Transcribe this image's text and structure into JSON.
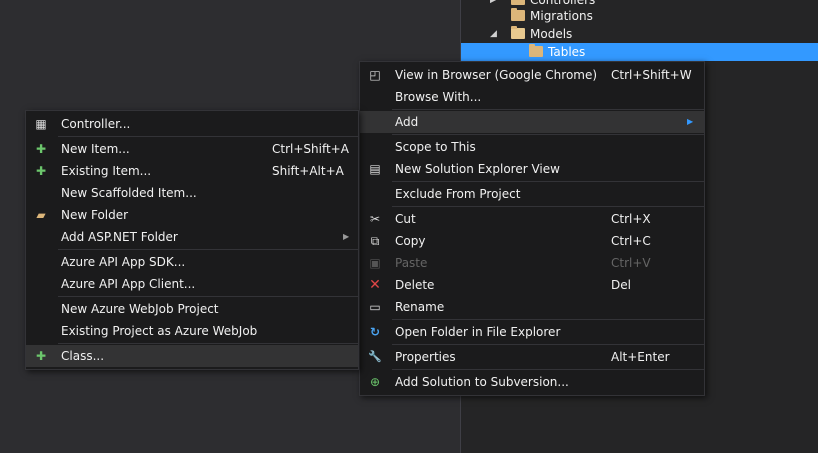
{
  "solution_explorer": {
    "items": [
      {
        "label": "Controllers",
        "arrow": "▶",
        "icon": "folder-icon"
      },
      {
        "label": "Migrations",
        "arrow": "",
        "icon": "folder-icon"
      },
      {
        "label": "Models",
        "arrow": "◢",
        "icon": "folder-open-icon"
      },
      {
        "label": "Tables",
        "arrow": "",
        "icon": "folder-icon",
        "selected": true
      }
    ]
  },
  "context_menu": {
    "items": [
      {
        "label": "View in Browser (Google Chrome)",
        "shortcut": "Ctrl+Shift+W",
        "icon": "browser-icon",
        "glyph": "◰"
      },
      {
        "label": "Browse With...",
        "shortcut": "",
        "icon": "",
        "glyph": ""
      },
      {
        "label": "Add",
        "shortcut": "",
        "icon": "",
        "glyph": "",
        "submenu_arrow": "▶"
      },
      {
        "label": "Scope to This",
        "shortcut": "",
        "icon": "",
        "glyph": ""
      },
      {
        "label": "New Solution Explorer View",
        "shortcut": "",
        "icon": "new-view-icon",
        "glyph": "▤"
      },
      {
        "label": "Exclude From Project",
        "shortcut": "",
        "icon": "",
        "glyph": ""
      },
      {
        "label": "Cut",
        "shortcut": "Ctrl+X",
        "icon": "scissors-icon",
        "glyph": "✂"
      },
      {
        "label": "Copy",
        "shortcut": "Ctrl+C",
        "icon": "copy-icon",
        "glyph": "⧉"
      },
      {
        "label": "Paste",
        "shortcut": "Ctrl+V",
        "icon": "paste-icon",
        "glyph": "▣"
      },
      {
        "label": "Delete",
        "shortcut": "Del",
        "icon": "delete-icon",
        "glyph": "✕"
      },
      {
        "label": "Rename",
        "shortcut": "",
        "icon": "rename-icon",
        "glyph": "▭"
      },
      {
        "label": "Open Folder in File Explorer",
        "shortcut": "",
        "icon": "open-folder-icon",
        "glyph": "↻"
      },
      {
        "label": "Properties",
        "shortcut": "Alt+Enter",
        "icon": "wrench-icon",
        "glyph": "🔧"
      },
      {
        "label": "Add Solution to Subversion...",
        "shortcut": "",
        "icon": "subversion-icon",
        "glyph": "⊕"
      }
    ]
  },
  "add_submenu": {
    "items": [
      {
        "label": "Controller...",
        "shortcut": "",
        "icon": "controller-icon",
        "glyph": "▦"
      },
      {
        "label": "New Item...",
        "shortcut": "Ctrl+Shift+A",
        "icon": "new-item-icon",
        "glyph": "✚"
      },
      {
        "label": "Existing Item...",
        "shortcut": "Shift+Alt+A",
        "icon": "existing-item-icon",
        "glyph": "✚"
      },
      {
        "label": "New Scaffolded Item...",
        "shortcut": "",
        "icon": "",
        "glyph": ""
      },
      {
        "label": "New Folder",
        "shortcut": "",
        "icon": "new-folder-icon",
        "glyph": "▰"
      },
      {
        "label": "Add ASP.NET Folder",
        "shortcut": "",
        "icon": "",
        "glyph": "",
        "submenu_arrow": "▶"
      },
      {
        "label": "Azure API App SDK...",
        "shortcut": "",
        "icon": "",
        "glyph": ""
      },
      {
        "label": "Azure API App Client...",
        "shortcut": "",
        "icon": "",
        "glyph": ""
      },
      {
        "label": "New Azure WebJob Project",
        "shortcut": "",
        "icon": "",
        "glyph": ""
      },
      {
        "label": "Existing Project as Azure WebJob",
        "shortcut": "",
        "icon": "",
        "glyph": ""
      },
      {
        "label": "Class...",
        "shortcut": "",
        "icon": "add-class-icon",
        "glyph": "✚"
      }
    ]
  },
  "colors": {
    "selection": "#3399ff",
    "menu_bg": "#1b1b1c",
    "highlight": "#333334",
    "delete_icon": "#e04646",
    "folder": "#dcb67a"
  }
}
